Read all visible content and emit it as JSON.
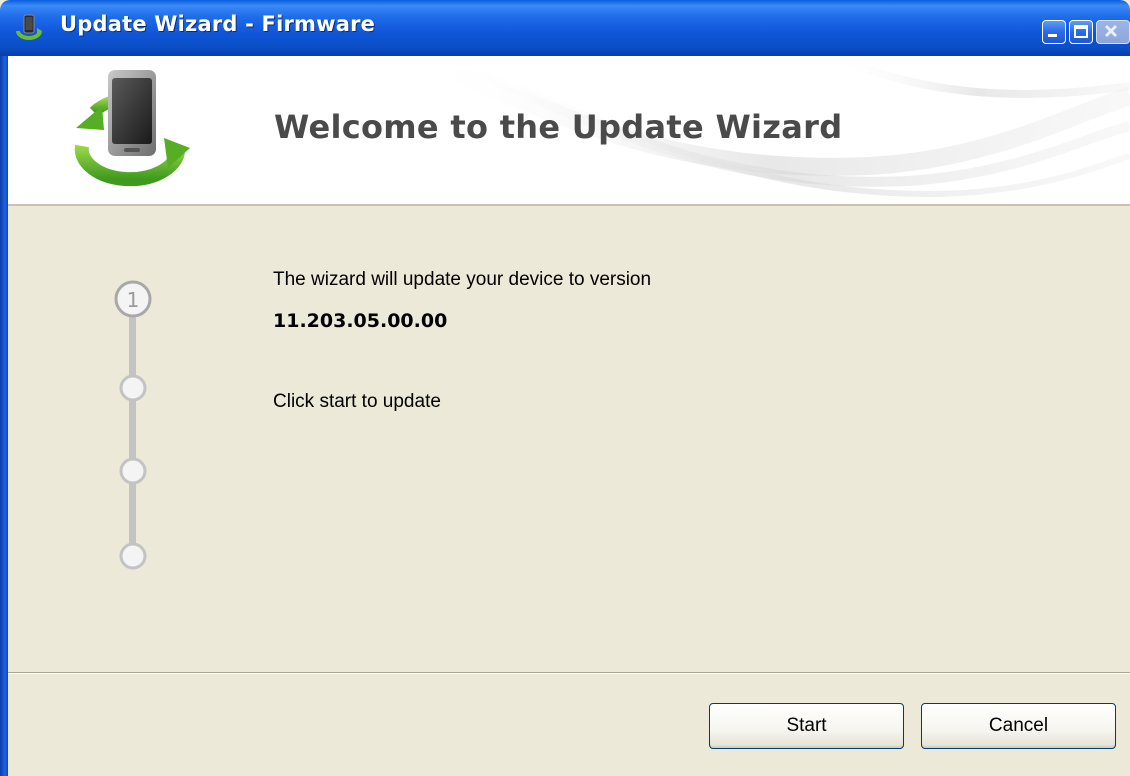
{
  "window": {
    "title": "Update Wizard - Firmware"
  },
  "titlebar": {
    "buttons": [
      "minimize-icon",
      "maximize-icon",
      "close-icon"
    ]
  },
  "header": {
    "title": "Welcome to the Update Wizard",
    "icon": "phone-sync-icon"
  },
  "stepper": {
    "current_step_label": "1",
    "total_steps": 4,
    "current_step": 1
  },
  "content": {
    "message": "The wizard will update your device to version",
    "version": "11.203.05.00.00",
    "instruction": "Click start to update"
  },
  "buttons": {
    "start_label": "Start",
    "cancel_label": "Cancel"
  },
  "colors": {
    "titlebar": "#0A4FC6",
    "content_bg": "#ECE9D8",
    "header_bg": "#FFFFFF",
    "title_text": "#4A4A4A",
    "step_gray": "#A8A8A8"
  }
}
